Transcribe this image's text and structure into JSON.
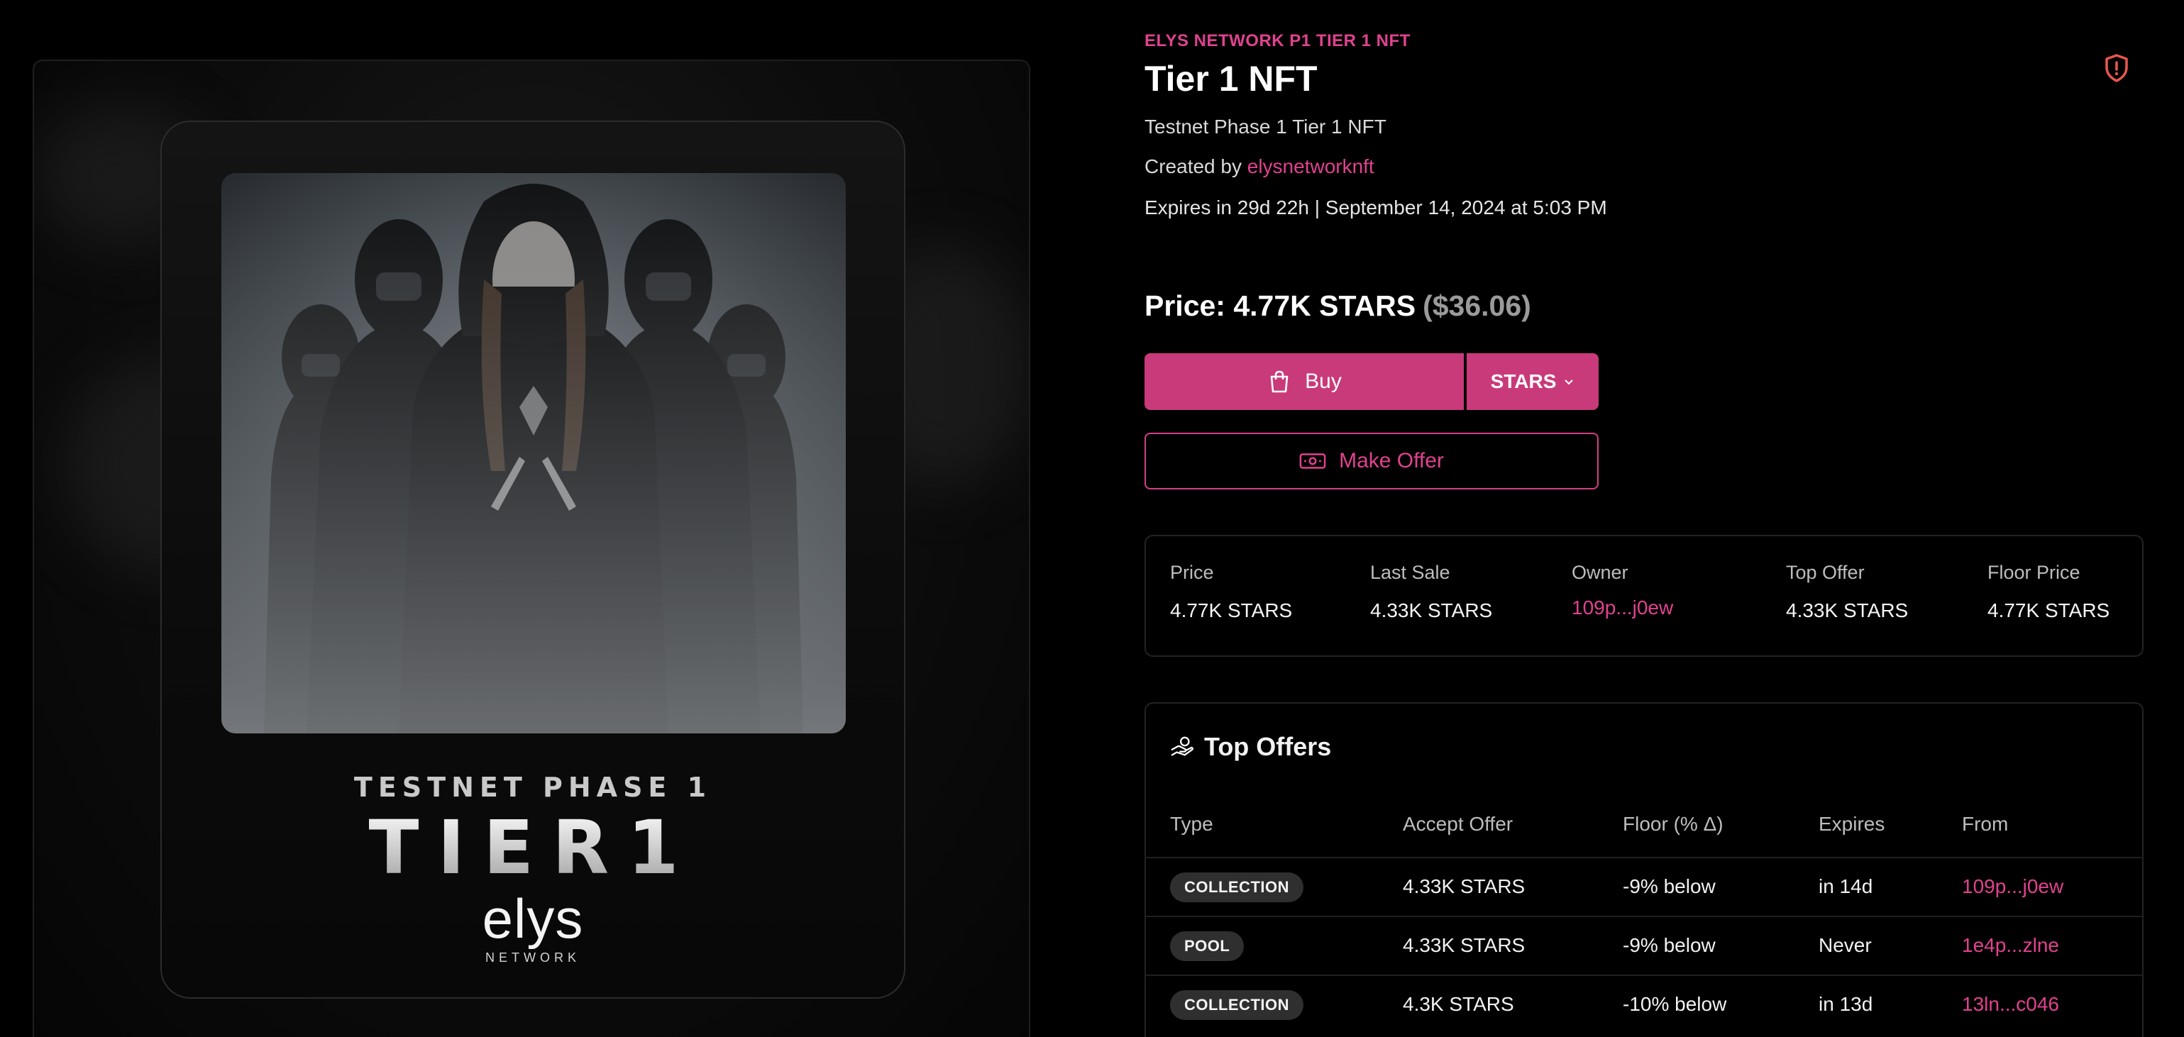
{
  "colors": {
    "accent": "#e0428f",
    "button": "#c93a7a",
    "background": "#000000"
  },
  "artwork": {
    "phase_text": "TESTNET PHASE 1",
    "tier_text": "TIER1",
    "brand_text": "elys",
    "brand_sub": "NETWORK"
  },
  "header": {
    "collection": "ELYS NETWORK P1 TIER 1 NFT",
    "title": "Tier 1 NFT",
    "report_icon": "shield-alert-icon",
    "description": "Testnet Phase 1 Tier 1 NFT",
    "created_by_label": "Created by",
    "creator": "elysnetworknft",
    "expires": "Expires in 29d 22h | September 14, 2024 at 5:03 PM"
  },
  "pricing": {
    "price": "Price: 4.77K STARS",
    "price_usd": "($36.06)",
    "buy_label": "Buy",
    "buy_icon": "shopping-bag-icon",
    "currency_label": "STARS",
    "currency_icon": "chevron-down-icon",
    "offer_label": "Make Offer",
    "offer_icon": "cash-icon"
  },
  "stats": [
    {
      "label": "Price",
      "value": "4.77K STARS"
    },
    {
      "label": "Last Sale",
      "value": "4.33K STARS"
    },
    {
      "label": "Owner",
      "value": "109p...j0ew"
    },
    {
      "label": "Top Offer",
      "value": "4.33K STARS"
    },
    {
      "label": "Floor Price",
      "value": "4.77K STARS"
    }
  ],
  "top_offers": {
    "title": "Top Offers",
    "icon": "hand-coins-icon",
    "columns": [
      "Type",
      "Accept Offer",
      "Floor (% Δ)",
      "Expires",
      "From"
    ],
    "rows": [
      {
        "type": "COLLECTION",
        "amount": "4.33K STARS",
        "floor": "-9% below",
        "expires": "in 14d",
        "from": "109p...j0ew"
      },
      {
        "type": "POOL",
        "amount": "4.33K STARS",
        "floor": "-9% below",
        "expires": "Never",
        "from": "1e4p...zlne"
      },
      {
        "type": "COLLECTION",
        "amount": "4.3K STARS",
        "floor": "-10% below",
        "expires": "in 13d",
        "from": "13ln...c046"
      }
    ]
  }
}
